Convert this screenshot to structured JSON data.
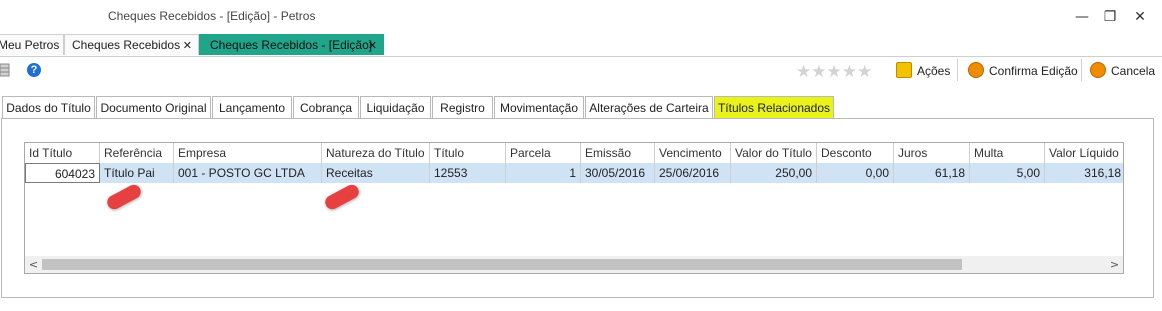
{
  "window": {
    "title": "Cheques Recebidos - [Edição] - Petros",
    "minimize_glyph": "—",
    "restore_glyph": "❐",
    "close_glyph": "✕"
  },
  "doc_tabs": [
    {
      "label": "Meu Petros"
    },
    {
      "label": "Cheques Recebidos",
      "close": "✕"
    },
    {
      "label": "Cheques Recebidos - [Edição]",
      "close": "✕",
      "active": true
    }
  ],
  "toolbar": {
    "stars": "★★★★★",
    "acoes_label": "Ações",
    "confirma_label": "Confirma Edição",
    "cancela_label": "Cancela",
    "help_glyph": "?"
  },
  "tabs": [
    {
      "label": "Dados do Título"
    },
    {
      "label": "Documento Original"
    },
    {
      "label": "Lançamento"
    },
    {
      "label": "Cobrança"
    },
    {
      "label": "Liquidação"
    },
    {
      "label": "Registro"
    },
    {
      "label": "Movimentação"
    },
    {
      "label": "Alterações de Carteira"
    },
    {
      "label": "Títulos Relacionados",
      "active": true
    }
  ],
  "grid": {
    "columns": [
      "Id Título",
      "Referência",
      "Empresa",
      "Natureza do Título",
      "Título",
      "Parcela",
      "Emissão",
      "Vencimento",
      "Valor do Título",
      "Desconto",
      "Juros",
      "Multa",
      "Valor Líquido"
    ],
    "rows": [
      [
        "604023",
        "Título Pai",
        "001 - POSTO GC LTDA",
        "Receitas",
        "12553",
        "1",
        "30/05/2016",
        "25/06/2016",
        "250,00",
        "0,00",
        "61,18",
        "5,00",
        "316,18"
      ]
    ],
    "scroll_left": "<",
    "scroll_right": ">"
  },
  "colors": {
    "active_doc_tab": "#20a48a",
    "active_tab": "#e9f21a",
    "selected_row": "#cfe3f5",
    "annotation_arrow": "#e64040"
  }
}
